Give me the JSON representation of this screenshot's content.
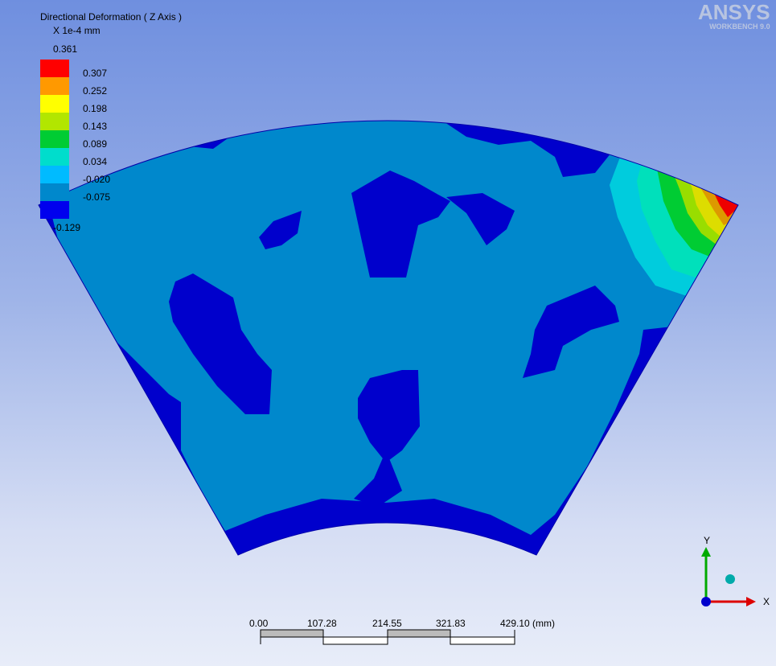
{
  "legend": {
    "title": "Directional Deformation ( Z Axis )",
    "units": "X 1e-4 mm",
    "max": "0.361",
    "min": "-0.129",
    "values": [
      "0.307",
      "0.252",
      "0.198",
      "0.143",
      "0.089",
      "0.034",
      "-0.020",
      "-0.075"
    ],
    "colors": [
      "#ff0000",
      "#ff9900",
      "#ffff00",
      "#b2e600",
      "#00cc33",
      "#00ddcc",
      "#00bbff",
      "#0088cc",
      "#0000ee"
    ]
  },
  "logo": {
    "name": "ANSYS",
    "product": "WORKBENCH 9.0"
  },
  "triad": {
    "y_label": "Y",
    "x_label": "X",
    "y_color": "#00aa00",
    "x_color": "#dd0000",
    "origin_color": "#0000cc"
  },
  "scale_bar": {
    "labels": [
      "0.00",
      "107.28",
      "214.55",
      "321.83",
      "429.10 (mm)"
    ]
  },
  "model": {
    "base_color": "#0000cc",
    "mid_color": "#0088cc"
  }
}
